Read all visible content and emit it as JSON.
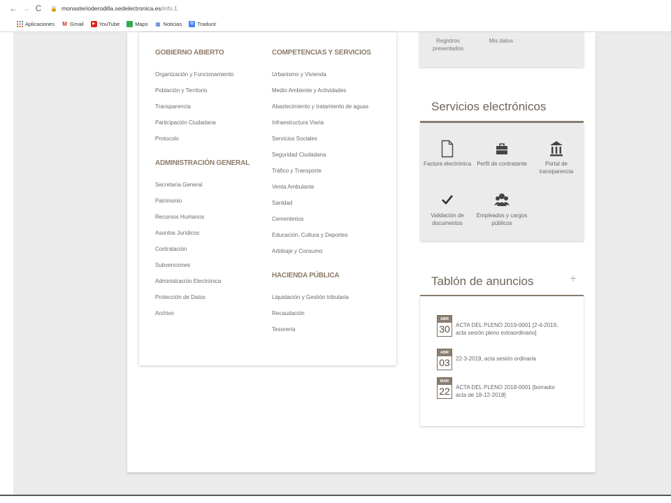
{
  "browser": {
    "url_domain": "monasterioderodilla.sedelectronica.es",
    "url_path": "/info.1",
    "bookmarks": [
      "Aplicaciones",
      "Gmail",
      "YouTube",
      "Maps",
      "Noticias",
      "Traducir"
    ]
  },
  "menu": {
    "gobierno_abierto": {
      "heading": "GOBIERNO ABIERTO",
      "links": [
        "Organización y Funcionamiento",
        "Población y Territorio",
        "Transparencia",
        "Participación Ciudadana",
        "Protocolo"
      ]
    },
    "administracion_general": {
      "heading": "ADMINISTRACIÓN GENERAL",
      "links": [
        "Secretaría General",
        "Patrimonio",
        "Recursos Humanos",
        "Asuntos Jurídicos",
        "Contratación",
        "Subvenciones",
        "Administración Electrónica",
        "Protección de Datos",
        "Archivo"
      ]
    },
    "competencias": {
      "heading": "COMPETENCIAS Y SERVICIOS",
      "links": [
        "Urbanismo y Vivienda",
        "Medio Ambiente y Actividades",
        "Abastecimiento y tratamiento de aguas",
        "Infraestructura Viaria",
        "Servicios Sociales",
        "Seguridad Ciudadana",
        "Tráfico y Transporte",
        "Venta Ambulante",
        "Sanidad",
        "Cementerios",
        "Educación, Cultura y Deportes",
        "Arbitraje y Consumo"
      ]
    },
    "hacienda": {
      "heading": "HACIENDA PÚBLICA",
      "links": [
        "Liquidación y Gestión tributaria",
        "Recaudación",
        "Tesorería"
      ]
    }
  },
  "top_card": {
    "registros": "Registros\npresentados",
    "mis_datos": "Mis datos"
  },
  "servicios": {
    "title": "Servicios electrónicos",
    "items": [
      {
        "label": "Factura electrónica",
        "icon": "document-icon"
      },
      {
        "label": "Perfil de contratante",
        "icon": "briefcase-icon"
      },
      {
        "label": "Portal de transparencia",
        "icon": "institution-icon"
      },
      {
        "label": "Validación de documentos",
        "icon": "checkmark-icon"
      },
      {
        "label": "Empleados y cargos públicos",
        "icon": "people-icon"
      }
    ]
  },
  "tablon": {
    "title": "Tablón de anuncios",
    "plus": "+",
    "notices": [
      {
        "month": "ABR",
        "day": "30",
        "text": "ACTA DEL PLENO 2019-0001 [2-4-2019, acta sesión pleno extraordinario]"
      },
      {
        "month": "ABR",
        "day": "03",
        "text": "22-3-2019, acta sesión ordinaria"
      },
      {
        "month": "MAR",
        "day": "22",
        "text": "ACTA DEL PLENO 2018-0001 [borrador acta de 18-12-2018]"
      }
    ]
  },
  "colors": {
    "accent": "#8a7e71",
    "heading": "#8b7a68"
  }
}
